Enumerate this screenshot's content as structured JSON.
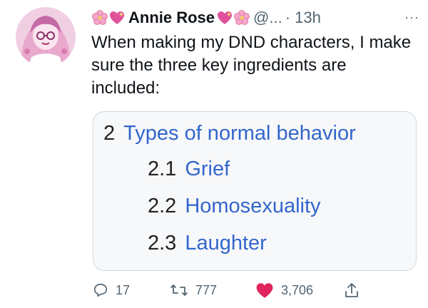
{
  "tweet": {
    "author": {
      "name": "Annie Rose",
      "handle": "@...",
      "time": "· 13h"
    },
    "more": "···",
    "text": "When making my DND characters, I make sure the three key ingredients are included:",
    "card": {
      "section": {
        "number": "2",
        "title": "Types of normal behavior"
      },
      "subsections": [
        {
          "number": "2.1",
          "title": "Grief"
        },
        {
          "number": "2.2",
          "title": "Homosexuality"
        },
        {
          "number": "2.3",
          "title": "Laughter"
        }
      ]
    },
    "actions": {
      "replies": "17",
      "retweets": "777",
      "likes": "3,706"
    }
  },
  "colors": {
    "link": "#3366cc",
    "like": "#e0245e",
    "muted": "#536471",
    "retweet": "#17bf63"
  },
  "icons": [
    "cherry-blossom-icon",
    "sparkling-heart-icon",
    "reply-icon",
    "retweet-icon",
    "heart-icon",
    "share-icon"
  ]
}
